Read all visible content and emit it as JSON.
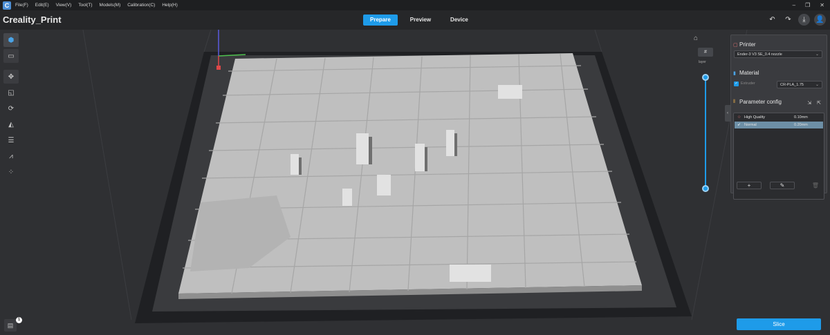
{
  "menubar": {
    "logo": "C",
    "items": [
      "File(F)",
      "Edit(E)",
      "View(V)",
      "Tool(T)",
      "Models(M)",
      "Calibration(C)",
      "Help(H)"
    ],
    "window_controls": [
      "–",
      "❐",
      "✕"
    ]
  },
  "titlebar": {
    "title": "Creality_Print",
    "tabs": [
      "Prepare",
      "Preview",
      "Device"
    ],
    "active_tab": "Prepare",
    "actions": [
      "↶",
      "↷",
      "⤓",
      "👤"
    ]
  },
  "left_toolbar": {
    "icons": [
      "cube-icon",
      "folder-icon",
      "move-icon",
      "scale-icon",
      "rotate-icon",
      "lay-flat-icon",
      "split-icon",
      "support-icon",
      "arrange-icon"
    ]
  },
  "right_controls": {
    "home_icon": "⌂",
    "layer_button": "#",
    "layer_label": "layer"
  },
  "panel": {
    "printer": {
      "title": "Printer",
      "selected": "Ender-3 V3 SE_0.4 nozzle"
    },
    "material": {
      "title": "Material",
      "extruder_label": "Extruder",
      "selected": "CR-PLA_1.75"
    },
    "parameter_config": {
      "title": "Parameter config",
      "profiles": [
        {
          "name": "High Quality",
          "value": "0.10mm",
          "selected": false
        },
        {
          "name": "Normal",
          "value": "0.20mm",
          "selected": true
        }
      ],
      "add_label": "+",
      "edit_label": "✎",
      "delete_label": "🗑"
    }
  },
  "bottom": {
    "slice_label": "Slice",
    "notification_count": "1"
  },
  "colors": {
    "accent": "#1e9be9",
    "background": "#2f3033",
    "model": "#c9c9c9"
  }
}
